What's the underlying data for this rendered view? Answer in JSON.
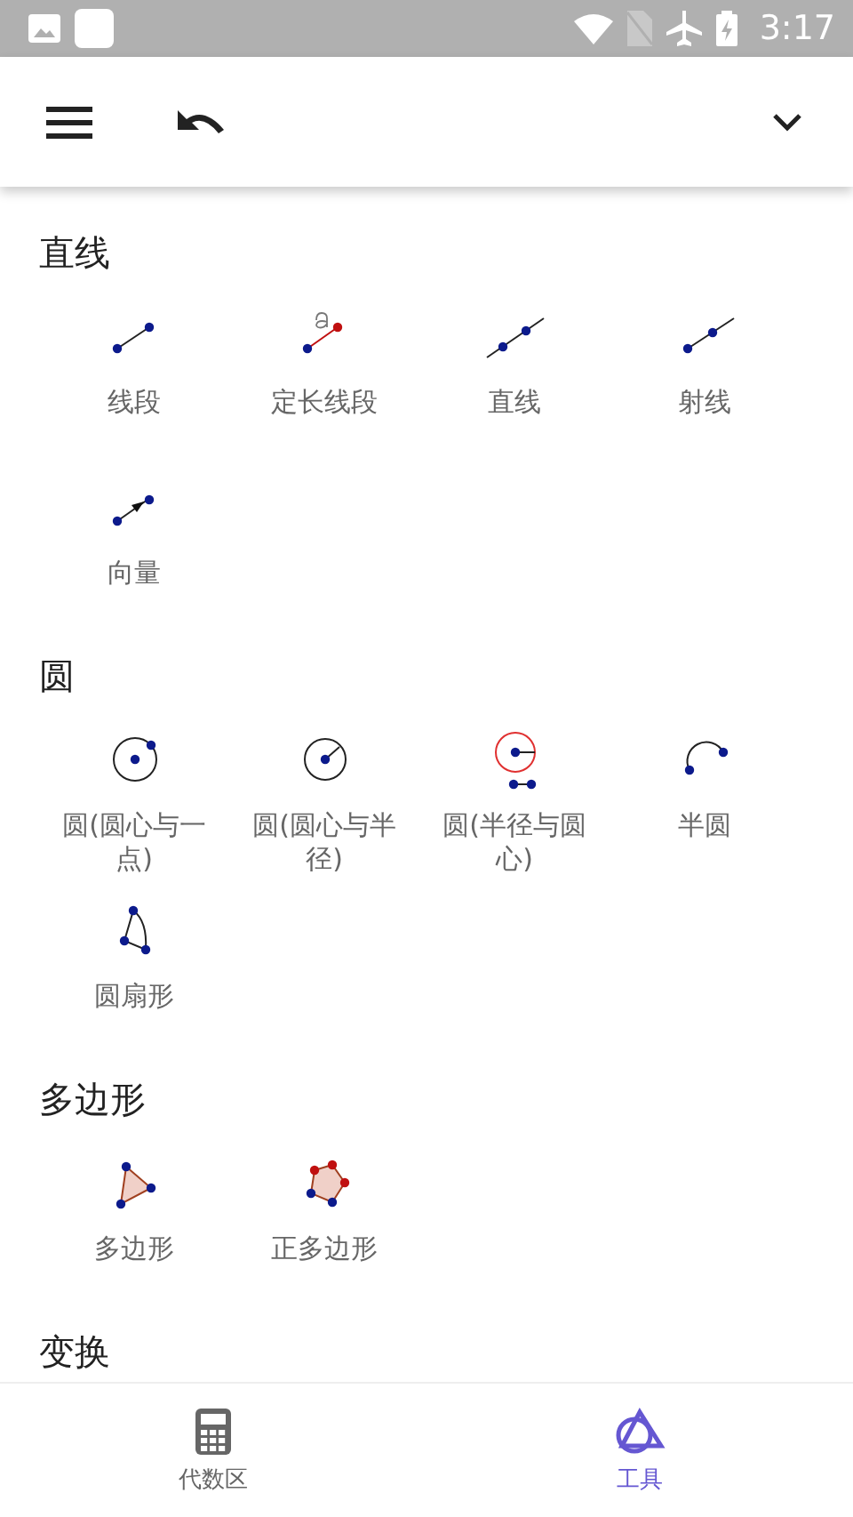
{
  "status_bar": {
    "time": "3:17"
  },
  "sections": [
    {
      "title": "直线",
      "tools": [
        {
          "label": "线段",
          "kind": "segment"
        },
        {
          "label": "定长线段",
          "kind": "fixed-segment"
        },
        {
          "label": "直线",
          "kind": "line"
        },
        {
          "label": "射线",
          "kind": "ray"
        },
        {
          "label": "向量",
          "kind": "vector"
        }
      ]
    },
    {
      "title": "圆",
      "tools": [
        {
          "label": "圆(圆心与一点)",
          "kind": "circle-point"
        },
        {
          "label": "圆(圆心与半径)",
          "kind": "circle-radius"
        },
        {
          "label": "圆(半径与圆心)",
          "kind": "compass"
        },
        {
          "label": "半圆",
          "kind": "semicircle"
        },
        {
          "label": "圆扇形",
          "kind": "sector"
        }
      ]
    },
    {
      "title": "多边形",
      "tools": [
        {
          "label": "多边形",
          "kind": "polygon"
        },
        {
          "label": "正多边形",
          "kind": "regular-polygon"
        }
      ]
    },
    {
      "title": "变换"
    }
  ],
  "bottom_nav": [
    {
      "label": "代数区",
      "kind": "calculator",
      "selected": false
    },
    {
      "label": "工具",
      "kind": "tools",
      "selected": true
    }
  ]
}
